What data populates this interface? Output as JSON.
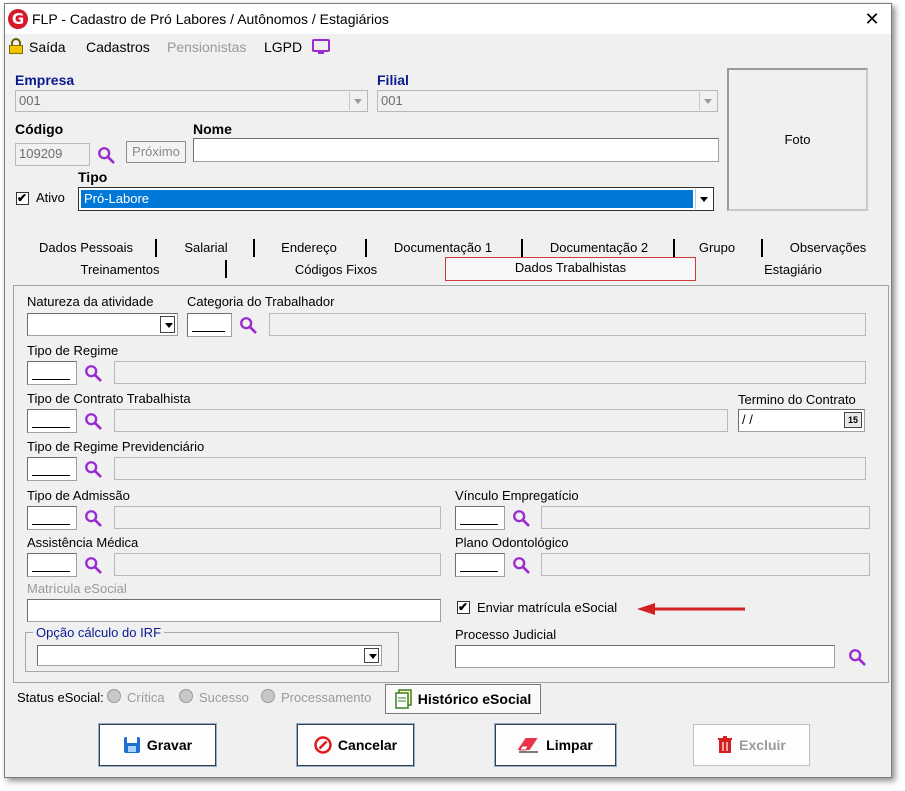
{
  "window": {
    "title": "FLP - Cadastro de Pró Labores / Autônomos / Estagiários",
    "logo_letter": "G"
  },
  "menu": {
    "saida": "Saída",
    "cadastros": "Cadastros",
    "pensionistas": "Pensionistas",
    "lgpd": "LGPD"
  },
  "header": {
    "empresa_label": "Empresa",
    "empresa_value": "001",
    "filial_label": "Filial",
    "filial_value": "001",
    "codigo_label": "Código",
    "codigo_value": "109209",
    "proximo_label": "Próximo",
    "nome_label": "Nome",
    "nome_value": "",
    "ativo_label": "Ativo",
    "ativo_checked": true,
    "tipo_label": "Tipo",
    "tipo_value": "Pró-Labore",
    "foto_label": "Foto"
  },
  "tabs_row1": [
    "Dados Pessoais",
    "Salarial",
    "Endereço",
    "Documentação 1",
    "Documentação 2",
    "Grupo",
    "Observações"
  ],
  "tabs_row2": [
    "Treinamentos",
    "Códigos Fixos",
    "Dados Trabalhistas",
    "Estagiário"
  ],
  "active_tab": "Dados Trabalhistas",
  "form": {
    "natureza_label": "Natureza da atividade",
    "categoria_label": "Categoria do Trabalhador",
    "tipo_regime_label": "Tipo de Regime",
    "tipo_contrato_label": "Tipo de Contrato Trabalhista",
    "termino_label": "Termino do Contrato",
    "termino_value": "/ /",
    "calendar_day": "15",
    "regime_prev_label": "Tipo de Regime Previdenciário",
    "tipo_admissao_label": "Tipo de Admissão",
    "vinculo_label": "Vínculo Empregatício",
    "assistencia_label": "Assistência Médica",
    "plano_label": "Plano Odontológico",
    "matricula_label": "Matrícula eSocial",
    "enviar_label": "Enviar matrícula eSocial",
    "enviar_checked": true,
    "irf_label": "Opção cálculo do IRF",
    "processo_label": "Processo Judicial"
  },
  "status": {
    "label": "Status eSocial:",
    "critica": "Crítica",
    "sucesso": "Sucesso",
    "processamento": "Processamento",
    "historico": "Histórico eSocial"
  },
  "buttons": {
    "gravar": "Gravar",
    "cancelar": "Cancelar",
    "limpar": "Limpar",
    "excluir": "Excluir"
  },
  "colors": {
    "accent_purple": "#9b2bd1",
    "selection_blue": "#0078d7",
    "label_blue": "#0b1a8f",
    "arrow_red": "#d42020"
  },
  "check_mark": "✔"
}
